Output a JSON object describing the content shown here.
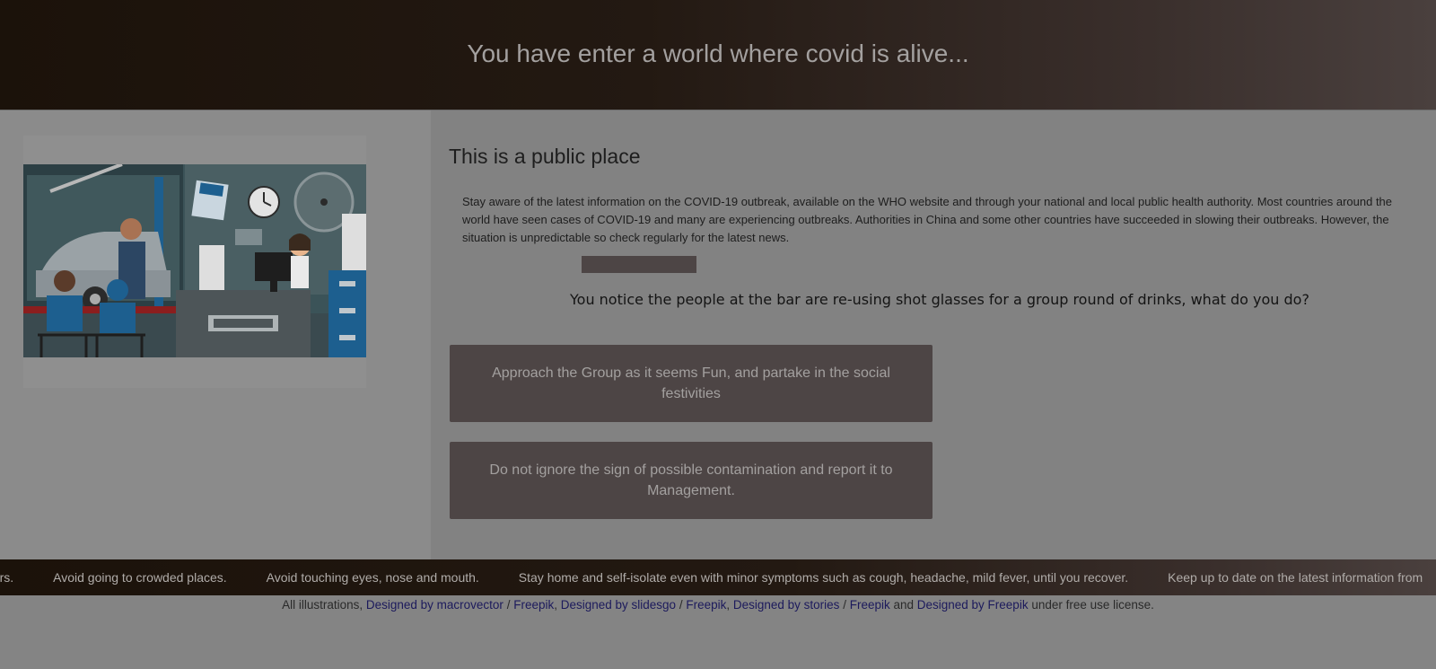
{
  "header": {
    "title": "You have enter a world where covid is alive..."
  },
  "main": {
    "section_title": "This is a public place",
    "info": "Stay aware of the latest information on the COVID-19 outbreak, available on the WHO website and through your national and local public health authority. Most countries around the world have seen cases of COVID-19 and many are experiencing outbreaks. Authorities in China and some other countries have succeeded in slowing their outbreaks. However, the situation is unpredictable so check regularly for the latest news.",
    "question": "You notice the people at the bar are re-using shot glasses for a group round of drinks, what do you do?",
    "choices": [
      "Approach the Group as it seems Fun, and partake in the social festivities",
      "Do not ignore the sign of possible contamination and report it to Management."
    ]
  },
  "ticker": {
    "items": [
      "hers.",
      "Avoid going to crowded places.",
      "Avoid touching eyes, nose and mouth.",
      "Stay home and self-isolate even with minor symptoms such as cough, headache, mild fever, until you recover.",
      "Keep up to date on the latest information from"
    ]
  },
  "footer": {
    "prefix": "All illustrations, ",
    "link1": "Designed by macrovector",
    "slash": " / ",
    "freepik": "Freepik",
    "comma": ", ",
    "link2": "Designed by slidesgo",
    "link3": "Designed by stories",
    "and": " and ",
    "link4": "Designed by Freepik",
    "suffix": " under free use license."
  },
  "colors": {
    "header_bg": "#1b120a",
    "button_bg": "#4d4545",
    "page_bg": "#848484",
    "link": "#1c1a5c"
  }
}
